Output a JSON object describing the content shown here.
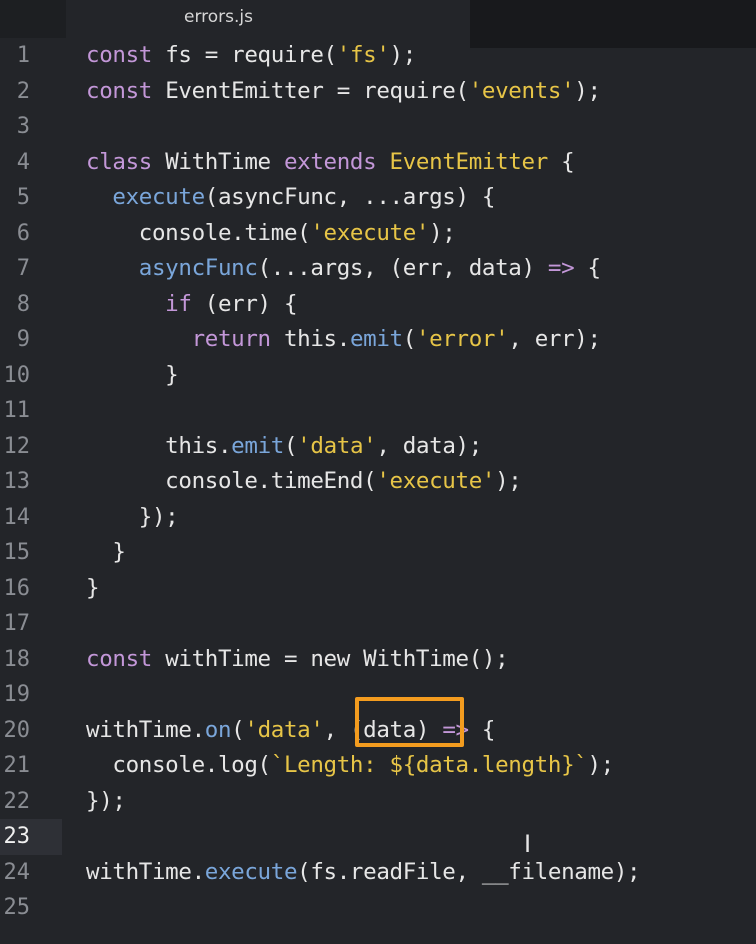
{
  "tab": {
    "title": "errors.js"
  },
  "active_line": 23,
  "lines": [
    {
      "n": "1",
      "tokens": [
        {
          "t": "const ",
          "c": "kw"
        },
        {
          "t": "fs = require(",
          "c": "plain"
        },
        {
          "t": "'fs'",
          "c": "str"
        },
        {
          "t": ");",
          "c": "plain"
        }
      ]
    },
    {
      "n": "2",
      "tokens": [
        {
          "t": "const ",
          "c": "kw"
        },
        {
          "t": "EventEmitter = require(",
          "c": "plain"
        },
        {
          "t": "'events'",
          "c": "str"
        },
        {
          "t": ");",
          "c": "plain"
        }
      ]
    },
    {
      "n": "3",
      "tokens": []
    },
    {
      "n": "4",
      "tokens": [
        {
          "t": "class ",
          "c": "kw"
        },
        {
          "t": "WithTime ",
          "c": "plain"
        },
        {
          "t": "extends ",
          "c": "kw"
        },
        {
          "t": "EventEmitter",
          "c": "cls"
        },
        {
          "t": " {",
          "c": "plain"
        }
      ]
    },
    {
      "n": "5",
      "tokens": [
        {
          "t": "  execute",
          "c": "fn"
        },
        {
          "t": "(asyncFunc, ...args) {",
          "c": "plain"
        }
      ]
    },
    {
      "n": "6",
      "tokens": [
        {
          "t": "    console.time(",
          "c": "plain"
        },
        {
          "t": "'execute'",
          "c": "str"
        },
        {
          "t": ");",
          "c": "plain"
        }
      ]
    },
    {
      "n": "7",
      "tokens": [
        {
          "t": "    asyncFunc",
          "c": "fn"
        },
        {
          "t": "(...args, (err, data) ",
          "c": "plain"
        },
        {
          "t": "=>",
          "c": "kw"
        },
        {
          "t": " {",
          "c": "plain"
        }
      ]
    },
    {
      "n": "8",
      "tokens": [
        {
          "t": "      if ",
          "c": "kw"
        },
        {
          "t": "(err) {",
          "c": "plain"
        }
      ]
    },
    {
      "n": "9",
      "tokens": [
        {
          "t": "        return ",
          "c": "kw"
        },
        {
          "t": "this.",
          "c": "plain"
        },
        {
          "t": "emit",
          "c": "fn"
        },
        {
          "t": "(",
          "c": "plain"
        },
        {
          "t": "'error'",
          "c": "str"
        },
        {
          "t": ", err);",
          "c": "plain"
        }
      ]
    },
    {
      "n": "10",
      "tokens": [
        {
          "t": "      }",
          "c": "plain"
        }
      ]
    },
    {
      "n": "11",
      "tokens": []
    },
    {
      "n": "12",
      "tokens": [
        {
          "t": "      this.",
          "c": "plain"
        },
        {
          "t": "emit",
          "c": "fn"
        },
        {
          "t": "(",
          "c": "plain"
        },
        {
          "t": "'data'",
          "c": "str"
        },
        {
          "t": ", data);",
          "c": "plain"
        }
      ]
    },
    {
      "n": "13",
      "tokens": [
        {
          "t": "      console.timeEnd(",
          "c": "plain"
        },
        {
          "t": "'execute'",
          "c": "str"
        },
        {
          "t": ");",
          "c": "plain"
        }
      ]
    },
    {
      "n": "14",
      "tokens": [
        {
          "t": "    });",
          "c": "plain"
        }
      ]
    },
    {
      "n": "15",
      "tokens": [
        {
          "t": "  }",
          "c": "plain"
        }
      ]
    },
    {
      "n": "16",
      "tokens": [
        {
          "t": "}",
          "c": "plain"
        }
      ]
    },
    {
      "n": "17",
      "tokens": []
    },
    {
      "n": "18",
      "tokens": [
        {
          "t": "const ",
          "c": "kw"
        },
        {
          "t": "withTime = new WithTime();",
          "c": "plain"
        }
      ]
    },
    {
      "n": "19",
      "tokens": []
    },
    {
      "n": "20",
      "tokens": [
        {
          "t": "withTime.",
          "c": "plain"
        },
        {
          "t": "on",
          "c": "fn"
        },
        {
          "t": "(",
          "c": "plain"
        },
        {
          "t": "'data'",
          "c": "str"
        },
        {
          "t": ", (data) ",
          "c": "plain"
        },
        {
          "t": "=>",
          "c": "kw"
        },
        {
          "t": " {",
          "c": "plain"
        }
      ]
    },
    {
      "n": "21",
      "tokens": [
        {
          "t": "  console.log(",
          "c": "plain"
        },
        {
          "t": "`Length: ${data.length}`",
          "c": "str"
        },
        {
          "t": ");",
          "c": "plain"
        }
      ]
    },
    {
      "n": "22",
      "tokens": [
        {
          "t": "});",
          "c": "plain"
        }
      ]
    },
    {
      "n": "23",
      "tokens": []
    },
    {
      "n": "24",
      "tokens": [
        {
          "t": "withTime.",
          "c": "plain"
        },
        {
          "t": "execute",
          "c": "fn"
        },
        {
          "t": "(fs.readFile, __filename);",
          "c": "plain"
        }
      ]
    },
    {
      "n": "25",
      "tokens": []
    }
  ],
  "colors": {
    "background": "#232529",
    "keyword": "#c397d8",
    "string": "#e7c547",
    "function": "#7aa6da",
    "highlight_box": "#f39c1f"
  },
  "icons": {
    "cursor": "text-cursor-icon"
  }
}
